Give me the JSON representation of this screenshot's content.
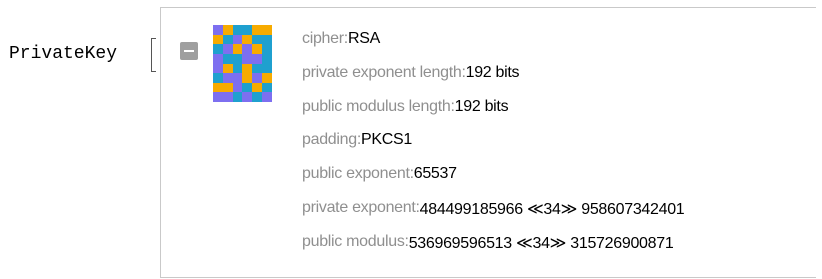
{
  "expression": {
    "head": "PrivateKey"
  },
  "key_icon": {
    "colors": [
      "#7d6ff0",
      "#1fa0cf",
      "#f7ab00"
    ],
    "pattern": [
      [
        0,
        2,
        1,
        1,
        2,
        2
      ],
      [
        2,
        1,
        0,
        2,
        1,
        1
      ],
      [
        1,
        0,
        2,
        0,
        2,
        1
      ],
      [
        0,
        1,
        1,
        0,
        0,
        1
      ],
      [
        0,
        2,
        1,
        2,
        1,
        1
      ],
      [
        1,
        0,
        0,
        2,
        0,
        2
      ],
      [
        2,
        2,
        0,
        1,
        2,
        1
      ],
      [
        0,
        0,
        1,
        0,
        1,
        0
      ]
    ]
  },
  "fields": [
    {
      "label": "cipher: ",
      "value": "RSA"
    },
    {
      "label": "private exponent length: ",
      "value": "192 bits"
    },
    {
      "label": "public modulus length: ",
      "value": "192 bits"
    },
    {
      "label": "padding: ",
      "value": "PKCS1"
    },
    {
      "label": "public exponent: ",
      "value": "65537"
    },
    {
      "label": "private exponent: ",
      "value": "484499185966 ≪34≫ 958607342401"
    },
    {
      "label": "public modulus: ",
      "value": "536969596513 ≪34≫ 315726900871"
    }
  ]
}
